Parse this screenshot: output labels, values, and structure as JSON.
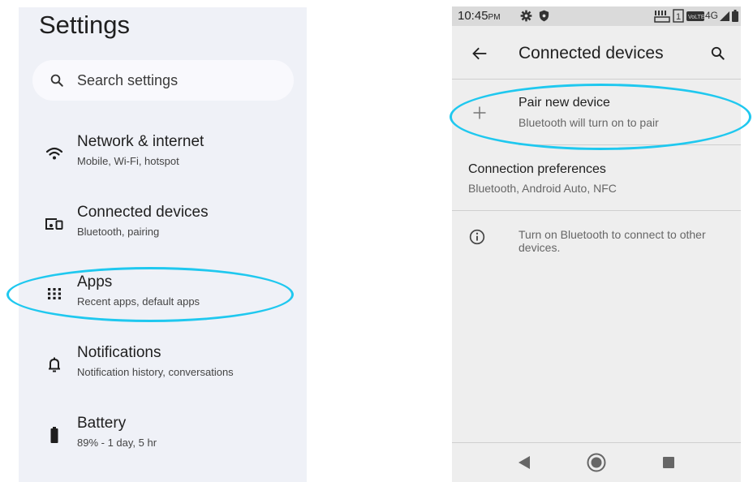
{
  "left": {
    "title": "Settings",
    "search_placeholder": "Search settings",
    "items": [
      {
        "label": "Network & internet",
        "sub": "Mobile, Wi-Fi, hotspot",
        "icon": "wifi-icon"
      },
      {
        "label": "Connected devices",
        "sub": "Bluetooth, pairing",
        "icon": "devices-icon"
      },
      {
        "label": "Apps",
        "sub": "Recent apps, default apps",
        "icon": "apps-grid-icon"
      },
      {
        "label": "Notifications",
        "sub": "Notification history, conversations",
        "icon": "bell-icon"
      },
      {
        "label": "Battery",
        "sub": "89% - 1 day, 5 hr",
        "icon": "battery-icon"
      }
    ]
  },
  "right": {
    "status": {
      "time": "10:45",
      "ampm": "PM",
      "network": "4G"
    },
    "title": "Connected devices",
    "pair": {
      "label": "Pair new device",
      "sub": "Bluetooth will turn on to pair"
    },
    "prefs": {
      "label": "Connection preferences",
      "sub": "Bluetooth, Android Auto, NFC"
    },
    "info": "Turn on Bluetooth to connect to other devices."
  },
  "colors": {
    "highlight": "#1fc8ef",
    "left_bg": "#eff1f7",
    "right_bg": "#eeeeee"
  }
}
